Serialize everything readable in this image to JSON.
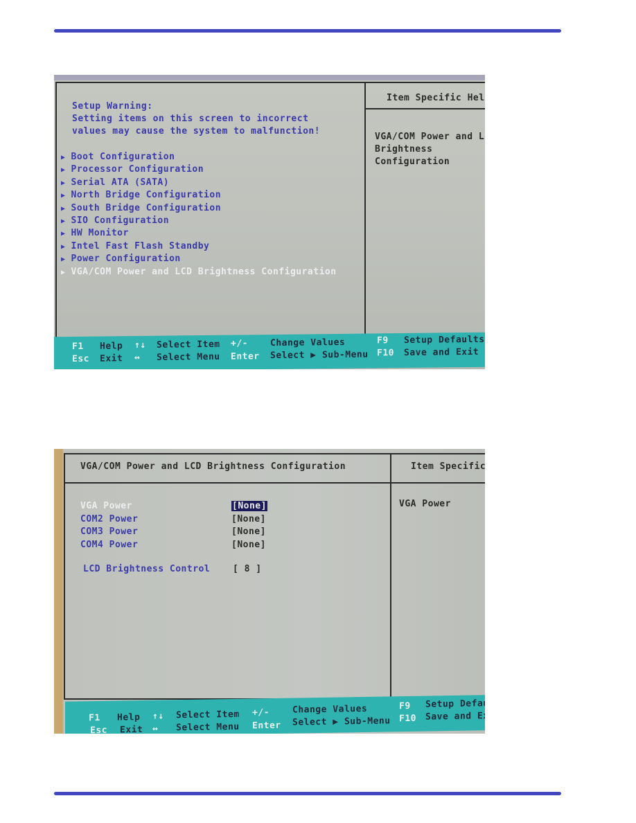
{
  "screen1": {
    "warning_title": "Setup Warning:",
    "warning_line1": "Setting items on this screen to incorrect",
    "warning_line2": "values may cause the system to malfunction!",
    "menu_items": [
      {
        "label": "Boot Configuration",
        "selected": false
      },
      {
        "label": "Processor Configuration",
        "selected": false
      },
      {
        "label": "Serial ATA (SATA)",
        "selected": false
      },
      {
        "label": "North Bridge Configuration",
        "selected": false
      },
      {
        "label": "South Bridge Configuration",
        "selected": false
      },
      {
        "label": "SIO Configuration",
        "selected": false
      },
      {
        "label": "HW Monitor",
        "selected": false
      },
      {
        "label": "Intel Fast Flash Standby",
        "selected": false
      },
      {
        "label": "Power Configuration",
        "selected": false
      },
      {
        "label": "VGA/COM Power and LCD Brightness Configuration",
        "selected": true
      }
    ],
    "help_title": "Item Specific Help",
    "help_lines": [
      "VGA/COM Power and LCD",
      "Brightness",
      "Configuration"
    ]
  },
  "screen2": {
    "title": "VGA/COM Power and LCD Brightness Configuration",
    "help_title": "Item Specific",
    "help_text": "VGA Power",
    "settings": [
      {
        "label": "VGA Power",
        "value": "[None]",
        "selected": true
      },
      {
        "label": "COM2 Power",
        "value": "[None]",
        "selected": false
      },
      {
        "label": "COM3 Power",
        "value": "[None]",
        "selected": false
      },
      {
        "label": "COM4 Power",
        "value": "[None]",
        "selected": false
      }
    ],
    "brightness": {
      "label": "LCD Brightness Control",
      "value": "[ 8 ]"
    }
  },
  "footer": {
    "f1": "F1",
    "help": "Help",
    "updown": "↑↓",
    "select_item": "Select Item",
    "plusminus": "+/-",
    "change_values": "Change Values",
    "f9": "F9",
    "setup_defaults": "Setup Defaults",
    "esc": "Esc",
    "exit": "Exit",
    "leftright": "↔",
    "select_menu": "Select Menu",
    "enter": "Enter",
    "select_submenu": "Select ▶ Sub-Menu",
    "f10": "F10",
    "save_exit": "Save and Exit"
  },
  "footer2": {
    "setup_defaults": "Setup Defau",
    "save_exit": "Save and Exi"
  },
  "colors": {
    "rule": "#4047c0",
    "menu_text": "#3a3aa8",
    "footer_bg": "#2fb3b0"
  }
}
